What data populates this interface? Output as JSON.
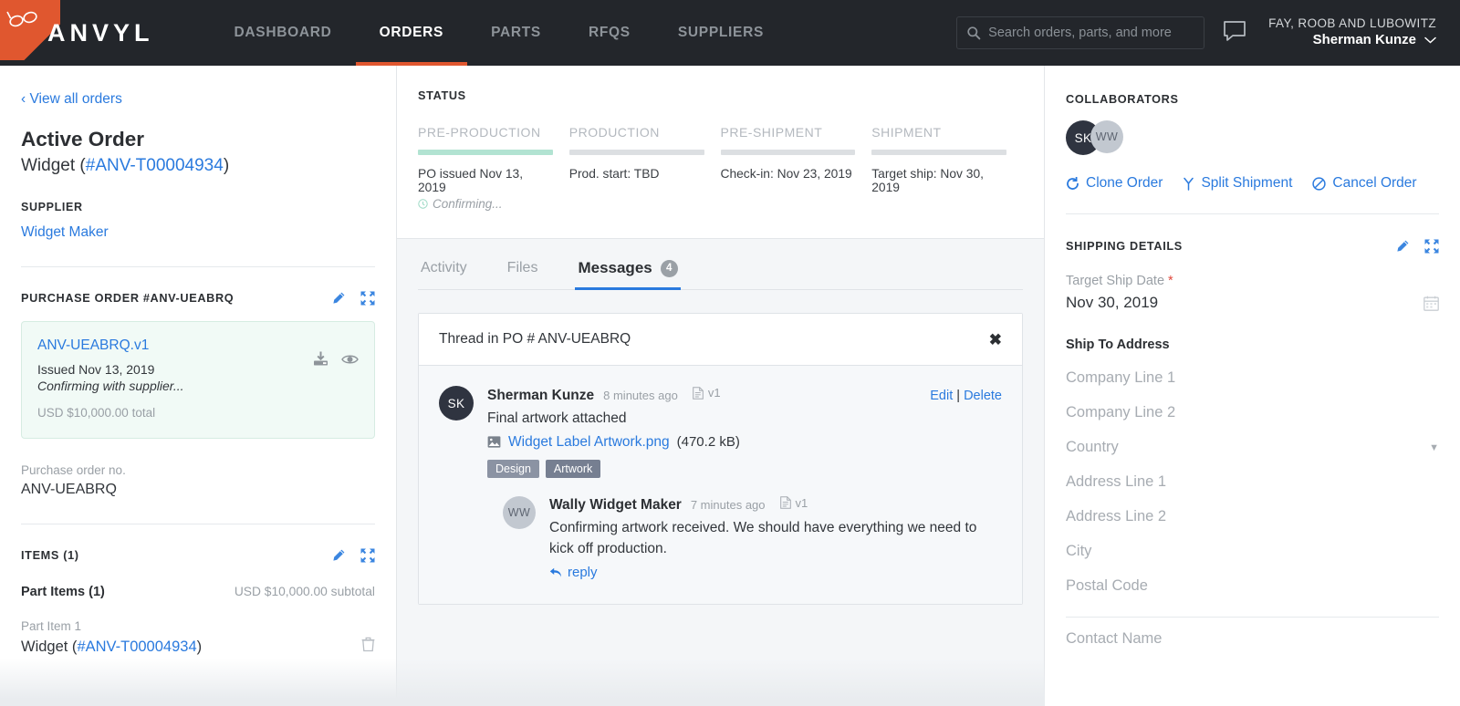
{
  "topnav": {
    "brand": "ANVYL",
    "logo_corner_color": "#e0572f",
    "accent_color": "#e0572f",
    "links": [
      {
        "label": "DASHBOARD",
        "active": false
      },
      {
        "label": "ORDERS",
        "active": true
      },
      {
        "label": "PARTS",
        "active": false
      },
      {
        "label": "RFQS",
        "active": false
      },
      {
        "label": "SUPPLIERS",
        "active": false
      }
    ],
    "search": {
      "value": "",
      "placeholder": "Search orders, parts, and more"
    },
    "user": {
      "org": "FAY, ROOB AND LUBOWITZ",
      "name": "Sherman Kunze"
    }
  },
  "left": {
    "back_link": "‹ View all orders",
    "order_status_title": "Active Order",
    "order_name": "Widget (",
    "order_id": "#ANV-T00004934",
    "order_name_close": ")",
    "supplier_label": "SUPPLIER",
    "supplier_name": "Widget Maker",
    "po_section_title": "PURCHASE ORDER #ANV-UEABRQ",
    "po_card": {
      "name": "ANV-UEABRQ.v1",
      "issued": "Issued Nov 13, 2019",
      "status": "Confirming with supplier...",
      "total": "USD $10,000.00 total"
    },
    "po_no_label": "Purchase order no.",
    "po_no_value": "ANV-UEABRQ",
    "items_section_title": "ITEMS (1)",
    "part_items_label": "Part Items (1)",
    "part_items_subtotal": "USD $10,000.00 subtotal",
    "part_item_label": "Part Item 1",
    "part_item_name": "Widget (",
    "part_item_id": "#ANV-T00004934",
    "part_item_close": ")"
  },
  "status": {
    "title": "STATUS",
    "done_color": "#b2e3d2",
    "pending_color": "#dcdfe2",
    "stages": [
      {
        "name": "PRE-PRODUCTION",
        "meta": "PO issued Nov 13, 2019",
        "sub": "Confirming...",
        "done": true
      },
      {
        "name": "PRODUCTION",
        "meta": "Prod. start: TBD",
        "sub": "",
        "done": false
      },
      {
        "name": "PRE-SHIPMENT",
        "meta": "Check-in: Nov 23, 2019",
        "sub": "",
        "done": false
      },
      {
        "name": "SHIPMENT",
        "meta": "Target ship: Nov 30, 2019",
        "sub": "",
        "done": false
      }
    ]
  },
  "tabs": [
    {
      "label": "Activity",
      "badge": "",
      "active": false
    },
    {
      "label": "Files",
      "badge": "",
      "active": false
    },
    {
      "label": "Messages",
      "badge": "4",
      "active": true
    }
  ],
  "thread": {
    "header": "Thread in PO # ANV-UEABRQ",
    "close": "✖",
    "messages": [
      {
        "initials": "SK",
        "author": "Sherman Kunze",
        "time": "8 minutes ago",
        "version": "v1",
        "text": "Final artwork attached",
        "attachment_name": "Widget Label Artwork.png",
        "attachment_size": "(470.2 kB)",
        "tags": [
          "Design",
          "Artwork"
        ],
        "edit": "Edit",
        "separator": "|",
        "delete": "Delete"
      },
      {
        "initials": "WW",
        "author": "Wally Widget Maker",
        "time": "7 minutes ago",
        "version": "v1",
        "text": "Confirming artwork received. We should have everything we need to kick off production.",
        "reply": "reply"
      }
    ]
  },
  "right": {
    "collaborators_title": "COLLABORATORS",
    "collaborators": [
      {
        "initials": "SK",
        "style": "dark"
      },
      {
        "initials": "WW",
        "style": "gray"
      }
    ],
    "order_actions": [
      {
        "label": "Clone Order",
        "icon": "refresh-icon"
      },
      {
        "label": "Split Shipment",
        "icon": "branch-icon"
      },
      {
        "label": "Cancel Order",
        "icon": "ban-icon"
      }
    ],
    "shipping_title": "SHIPPING DETAILS",
    "target_ship_label": "Target Ship Date",
    "target_ship_required": "*",
    "target_ship_value": "Nov 30, 2019",
    "ship_to_label": "Ship To Address",
    "address_fields": [
      {
        "placeholder": "Company Line 1",
        "type": "text"
      },
      {
        "placeholder": "Company Line 2",
        "type": "text"
      },
      {
        "placeholder": "Country",
        "type": "select"
      },
      {
        "placeholder": "Address Line 1",
        "type": "text"
      },
      {
        "placeholder": "Address Line 2",
        "type": "text"
      },
      {
        "placeholder": "City",
        "type": "text"
      },
      {
        "placeholder": "Postal Code",
        "type": "text"
      },
      {
        "placeholder": "Contact Name",
        "type": "text"
      }
    ]
  }
}
